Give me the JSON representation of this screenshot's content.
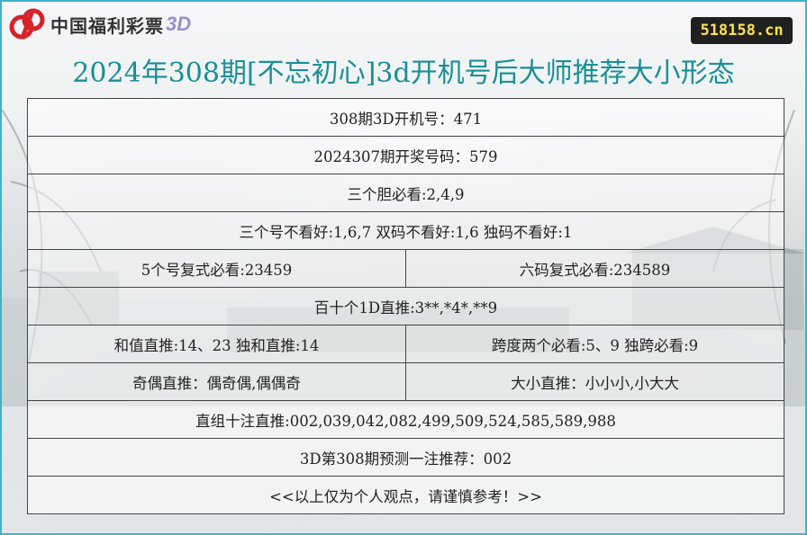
{
  "logo": {
    "text": "中国福利彩票",
    "suffix": "3D"
  },
  "site_badge": "518158.cn",
  "title": "2024年308期[不忘初心]3d开机号后大师推荐大小形态",
  "rows": {
    "r1": "308期3D开机号：471",
    "r2": "2024307期开奖号码：579",
    "r3": "三个胆必看:2,4,9",
    "r4": "三个号不看好:1,6,7  双码不看好:1,6  独码不看好:1",
    "r5a": "5个号复式必看:23459",
    "r5b": "六码复式必看:234589",
    "r6": "百十个1D直推:3**,*4*,**9",
    "r7a": "和值直推:14、23 独和直推:14",
    "r7b": "跨度两个必看:5、9  独跨必看:9",
    "r8a": "奇偶直推：偶奇偶,偶偶奇",
    "r8b": "大小直推：小小小,小大大",
    "r9": "直组十注直推:002,039,042,082,499,509,524,585,589,988",
    "r10": "3D第308期预测一注推荐：002",
    "r11": "<<以上仅为个人观点，请谨慎参考！>>"
  },
  "colors": {
    "title": "#1a8f96",
    "border": "#3fb3c6",
    "logo_red": "#d6232a",
    "badge_text": "#ffe24a"
  }
}
